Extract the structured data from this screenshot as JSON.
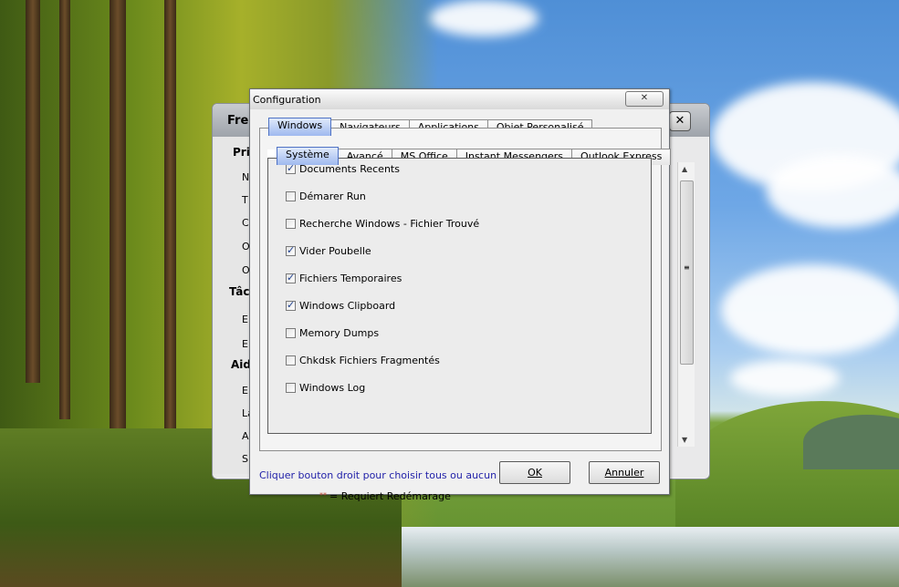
{
  "background_window": {
    "title": "Fre",
    "close_glyph": "✕",
    "sections": [
      {
        "heading": "Prin",
        "items": [
          "N",
          "T",
          "C",
          "O",
          "O"
        ]
      },
      {
        "heading": "Tâc",
        "items": [
          "E",
          "E"
        ]
      },
      {
        "heading": "Aid",
        "items": [
          "E",
          "La",
          "A",
          "S"
        ]
      }
    ]
  },
  "dialog": {
    "title": "Configuration",
    "close_glyph": "✕",
    "top_tabs": [
      "Windows",
      "Navigateurs",
      "Applications",
      "Objet Personalisé"
    ],
    "active_top_tab": "Windows",
    "sub_tabs": [
      "Système",
      "Avancé",
      "MS Office",
      "Instant Messengers",
      "Outlook Express"
    ],
    "active_sub_tab": "Système",
    "options": [
      {
        "label": "Documents Recents",
        "checked": true
      },
      {
        "label": "Démarer Run",
        "checked": false
      },
      {
        "label": "Recherche Windows - Fichier Trouvé",
        "checked": false
      },
      {
        "label": "Vider Poubelle",
        "checked": true
      },
      {
        "label": "Fichiers Temporaires",
        "checked": true
      },
      {
        "label": "Windows Clipboard",
        "checked": true
      },
      {
        "label": "Memory Dumps",
        "checked": false
      },
      {
        "label": "Chkdsk Fichiers Fragmentés",
        "checked": false
      },
      {
        "label": "Windows Log",
        "checked": false
      }
    ],
    "note_stars": "**",
    "note_text": "= Requiert Redémarage",
    "hint": "Cliquer bouton droit pour choisir tous ou aucun",
    "ok_label": "OK",
    "cancel_label": "Annuler"
  },
  "colors": {
    "active_tab": "#9fb9ef",
    "hint_text": "#1f1fa8",
    "check_mark": "#1e3f8f"
  }
}
